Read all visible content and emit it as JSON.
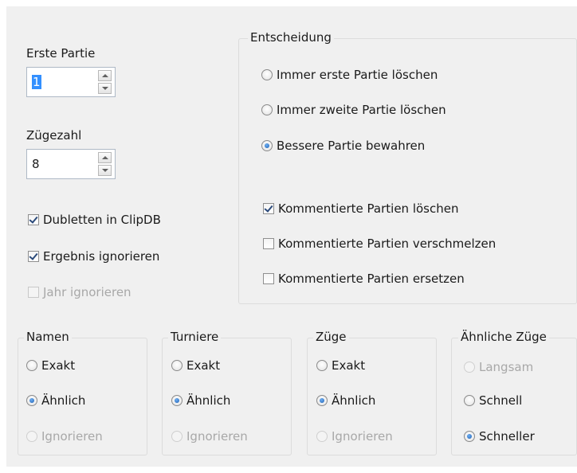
{
  "erste_partie": {
    "label": "Erste Partie",
    "value": "1"
  },
  "zuegezahl": {
    "label": "Zügezahl",
    "value": "8"
  },
  "checkboxes_left": [
    {
      "label": "Dubletten in ClipDB",
      "checked": true,
      "enabled": true
    },
    {
      "label": "Ergebnis ignorieren",
      "checked": true,
      "enabled": true
    },
    {
      "label": "Jahr ignorieren",
      "checked": false,
      "enabled": false
    }
  ],
  "entscheidung": {
    "title": "Entscheidung",
    "radios": [
      {
        "label": "Immer erste Partie löschen",
        "selected": false
      },
      {
        "label": "Immer zweite Partie löschen",
        "selected": false
      },
      {
        "label": "Bessere Partie bewahren",
        "selected": true
      }
    ],
    "checkboxes": [
      {
        "label": "Kommentierte Partien löschen",
        "checked": true
      },
      {
        "label": "Kommentierte Partien verschmelzen",
        "checked": false
      },
      {
        "label": "Kommentierte Partien ersetzen",
        "checked": false
      }
    ]
  },
  "groups": [
    {
      "title": "Namen",
      "options": [
        {
          "label": "Exakt",
          "selected": false,
          "enabled": true
        },
        {
          "label": "Ähnlich",
          "selected": true,
          "enabled": true
        },
        {
          "label": "Ignorieren",
          "selected": false,
          "enabled": false
        }
      ]
    },
    {
      "title": "Turniere",
      "options": [
        {
          "label": "Exakt",
          "selected": false,
          "enabled": true
        },
        {
          "label": "Ähnlich",
          "selected": true,
          "enabled": true
        },
        {
          "label": "Ignorieren",
          "selected": false,
          "enabled": false
        }
      ]
    },
    {
      "title": "Züge",
      "options": [
        {
          "label": "Exakt",
          "selected": false,
          "enabled": true
        },
        {
          "label": "Ähnlich",
          "selected": true,
          "enabled": true
        },
        {
          "label": "Ignorieren",
          "selected": false,
          "enabled": false
        }
      ]
    },
    {
      "title": "Ähnliche Züge",
      "options": [
        {
          "label": "Langsam",
          "selected": false,
          "enabled": false
        },
        {
          "label": "Schnell",
          "selected": false,
          "enabled": true
        },
        {
          "label": "Schneller",
          "selected": true,
          "enabled": true
        }
      ]
    }
  ]
}
